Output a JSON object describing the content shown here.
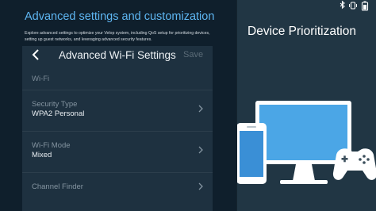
{
  "hero": {
    "title": "Advanced settings and customization",
    "description": "Explore advanced settings to optimize your Velop system, including QoS setup for prioritizing devices, setting up guest networks, and leveraging advanced security features."
  },
  "settings": {
    "header_title": "Advanced Wi-Fi Settings",
    "save_label": "Save",
    "section_label": "Wi-Fi",
    "rows": [
      {
        "label": "Security Type",
        "value": "WPA2 Personal"
      },
      {
        "label": "Wi-Fi Mode",
        "value": "Mixed"
      },
      {
        "label": "Channel Finder",
        "value": ""
      }
    ]
  },
  "promo": {
    "title": "Device Prioritization"
  },
  "colors": {
    "accent": "#5eb6f2",
    "left_background": "#0f1f2c",
    "settings_background": "#1e3140",
    "right_background": "#213644",
    "monitor_screen": "#4ba6e6",
    "phone_screen": "#3a8fd6"
  },
  "icons": {
    "back": "chevron-left-icon",
    "row_chevron": "chevron-right-icon",
    "status": [
      "bluetooth-icon",
      "vibrate-icon",
      "battery-icon"
    ],
    "illustration": [
      "monitor-icon",
      "phone-icon",
      "gamepad-icon"
    ]
  }
}
